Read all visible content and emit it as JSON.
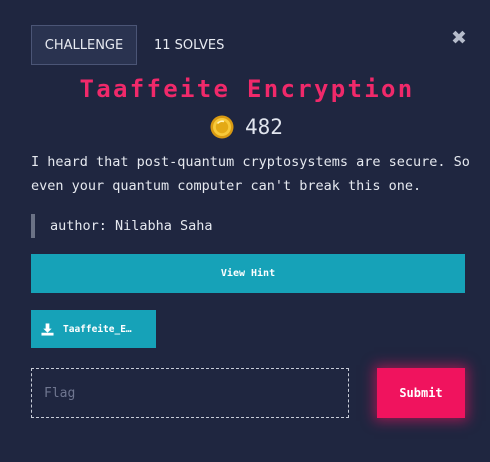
{
  "header": {
    "tabs": [
      {
        "label": "CHALLENGE",
        "active": true
      },
      {
        "label": "11 SOLVES",
        "active": false
      }
    ],
    "close_label": "✖"
  },
  "challenge": {
    "title": "Taaffeite Encryption",
    "points": "482",
    "point_icon": "coin-icon",
    "description": "I heard that post-quantum cryptosystems are secure. So even your quantum computer can't break this one.",
    "author": "author: Nilabha Saha"
  },
  "actions": {
    "hint_label": "View Hint",
    "file_label": "Taaffeite_E…",
    "file_icon": "download-icon"
  },
  "submission": {
    "flag_placeholder": "Flag",
    "flag_value": "",
    "submit_label": "Submit"
  },
  "colors": {
    "background": "#1f2640",
    "title": "#f0296a",
    "accent": "#16a2b8",
    "submit": "#f0135e"
  }
}
